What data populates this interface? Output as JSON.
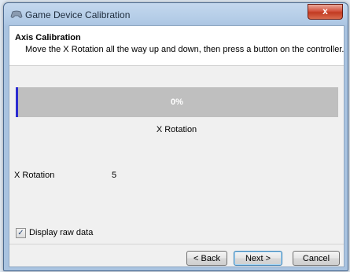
{
  "window": {
    "title": "Game Device Calibration",
    "close_label": "x"
  },
  "header": {
    "title": "Axis Calibration",
    "subtitle": "Move the X Rotation all the way up and down, then press a button on the controller."
  },
  "progress": {
    "value_percent": 0,
    "label": "0%",
    "axis_name": "X Rotation"
  },
  "raw_data": {
    "label": "X Rotation",
    "value": "5"
  },
  "checkbox": {
    "label": "Display raw data",
    "checked": true,
    "glyph": "✓"
  },
  "buttons": {
    "back": "< Back",
    "next": "Next >",
    "cancel": "Cancel"
  },
  "colors": {
    "progress_track": "#bfbfbf",
    "progress_marker": "#2b2bd0",
    "close_button": "#c23a22"
  }
}
